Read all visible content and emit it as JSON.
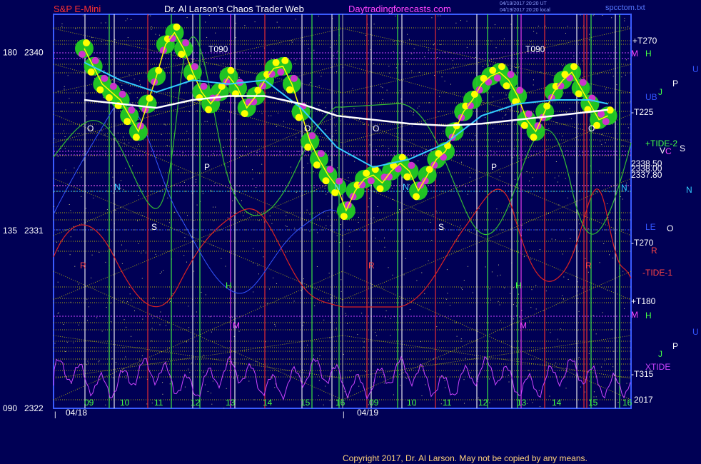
{
  "header": {
    "symbol": "S&P E-Mini",
    "site": "Dr. Al Larson's Chaos Trader Web",
    "url": "Daytradingforecasts.com",
    "stamp1": "04/19/2017 20:20 UT",
    "stamp2": "04/19/2017 20:20 local",
    "file": "spcctom.txt"
  },
  "colors": {
    "background": "#000055",
    "axis": "#3a5cff",
    "gridline": "#d0d000",
    "price_bar": "#ffff00",
    "body_green": "#22cc22",
    "magenta": "#cc33cc",
    "ma_white": "#ffffff",
    "ma_cyan": "#33ccff",
    "tide_green": "#33bb33",
    "tide_red": "#dd2222",
    "xtide": "#cc44ff"
  },
  "copyright": "Copyright 2017, Dr. Al Larson. May not be copied by any means.",
  "chart_data": {
    "type": "line",
    "price_axis": {
      "ticks": [
        {
          "angle": "180",
          "price": "2340",
          "value": 2340
        },
        {
          "angle": "135",
          "price": "2331",
          "value": 2331
        },
        {
          "angle": "090",
          "price": "2322",
          "value": 2322
        }
      ],
      "ylim": [
        2322,
        2341.5
      ]
    },
    "x_axis": {
      "hour_labels": [
        "09",
        "10",
        "11",
        "12",
        "13",
        "14",
        "15",
        "16",
        "09",
        "10",
        "11",
        "12",
        "13",
        "14",
        "15",
        "16"
      ],
      "date_labels": [
        "04/18",
        "04/19"
      ]
    },
    "right_labels": [
      {
        "text": "+T270",
        "color": "#ffffff"
      },
      {
        "text": "M",
        "color": "#ff44ff"
      },
      {
        "text": "H",
        "color": "#44ff44"
      },
      {
        "text": "U",
        "color": "#3355ff"
      },
      {
        "text": "P",
        "color": "#ffffff"
      },
      {
        "text": "J",
        "color": "#44ff44"
      },
      {
        "text": "UB",
        "color": "#3355ff"
      },
      {
        "text": "-T225",
        "color": "#ffffff"
      },
      {
        "text": "+TIDE-2",
        "color": "#44ff44"
      },
      {
        "text": "V",
        "color": "#ffffff"
      },
      {
        "text": "C",
        "color": "#ff44ff"
      },
      {
        "text": "S",
        "color": "#ffffff"
      },
      {
        "text": "2338.50",
        "color": "#ffffff"
      },
      {
        "text": "2338.00",
        "color": "#ffffff"
      },
      {
        "text": "2337.80",
        "color": "#ffffff"
      },
      {
        "text": "N",
        "color": "#33ccff"
      },
      {
        "text": "N",
        "color": "#33ccff"
      },
      {
        "text": "LE",
        "color": "#3355ff"
      },
      {
        "text": "O",
        "color": "#ffffff"
      },
      {
        "text": "-T270",
        "color": "#ffffff"
      },
      {
        "text": "R",
        "color": "#ff4444"
      },
      {
        "text": "-TIDE-1",
        "color": "#ff4444"
      },
      {
        "text": "+T180",
        "color": "#ffffff"
      },
      {
        "text": "M",
        "color": "#ff44ff"
      },
      {
        "text": "H",
        "color": "#44ff44"
      },
      {
        "text": "U",
        "color": "#3355ff"
      },
      {
        "text": "P",
        "color": "#ffffff"
      },
      {
        "text": "J",
        "color": "#44ff44"
      },
      {
        "text": "XTIDE",
        "color": "#cc44ff"
      },
      {
        "text": "-T315",
        "color": "#ffffff"
      },
      {
        "text": "2017",
        "color": "#ffffff"
      }
    ],
    "chart_labels": [
      {
        "text": "T090",
        "color": "#ffffff"
      },
      {
        "text": "T090",
        "color": "#ffffff"
      },
      {
        "text": "O",
        "color": "#ffffff"
      },
      {
        "text": "O",
        "color": "#ffffff"
      },
      {
        "text": "O",
        "color": "#ffffff"
      },
      {
        "text": "O",
        "color": "#ffffff"
      },
      {
        "text": "N",
        "color": "#33ccff"
      },
      {
        "text": "N",
        "color": "#33ccff"
      },
      {
        "text": "N",
        "color": "#33ccff"
      },
      {
        "text": "P",
        "color": "#ffffff"
      },
      {
        "text": "P",
        "color": "#ffffff"
      },
      {
        "text": "S",
        "color": "#ffffff"
      },
      {
        "text": "S",
        "color": "#ffffff"
      },
      {
        "text": "R",
        "color": "#ff4444"
      },
      {
        "text": "R",
        "color": "#ff4444"
      },
      {
        "text": "R",
        "color": "#ff4444"
      },
      {
        "text": "H",
        "color": "#44ff44"
      },
      {
        "text": "H",
        "color": "#44ff44"
      },
      {
        "text": "M",
        "color": "#ff44ff"
      },
      {
        "text": "M",
        "color": "#ff44ff"
      }
    ],
    "price_series": {
      "name": "",
      "points": [
        [
          0,
          2340.2
        ],
        [
          0.25,
          2339.3
        ],
        [
          0.5,
          2338.4
        ],
        [
          0.75,
          2338.0
        ],
        [
          1.0,
          2337.6
        ],
        [
          1.25,
          2336.8
        ],
        [
          1.5,
          2336.0
        ],
        [
          1.75,
          2337.4
        ],
        [
          2.0,
          2338.8
        ],
        [
          2.25,
          2340.4
        ],
        [
          2.5,
          2341.0
        ],
        [
          2.75,
          2340.2
        ],
        [
          3.0,
          2339.0
        ],
        [
          3.25,
          2338.0
        ],
        [
          3.5,
          2337.4
        ],
        [
          3.75,
          2338.0
        ],
        [
          4.0,
          2338.8
        ],
        [
          4.25,
          2338.2
        ],
        [
          4.5,
          2337.2
        ],
        [
          4.75,
          2337.8
        ],
        [
          5.0,
          2338.6
        ],
        [
          5.25,
          2339.2
        ],
        [
          5.5,
          2339.3
        ],
        [
          5.75,
          2338.4
        ],
        [
          6.0,
          2337.0
        ],
        [
          6.25,
          2335.5
        ],
        [
          6.5,
          2334.6
        ],
        [
          6.75,
          2333.8
        ],
        [
          7.0,
          2333.2
        ],
        [
          7.25,
          2332.0
        ],
        [
          7.5,
          2333.0
        ],
        [
          7.75,
          2333.6
        ],
        [
          8.0,
          2333.8
        ],
        [
          8.25,
          2333.4
        ],
        [
          8.5,
          2334.0
        ],
        [
          8.75,
          2334.4
        ],
        [
          9.0,
          2334.0
        ],
        [
          9.25,
          2333.0
        ],
        [
          9.5,
          2333.8
        ],
        [
          9.75,
          2334.6
        ],
        [
          10.0,
          2335.0
        ],
        [
          10.25,
          2336.0
        ],
        [
          10.5,
          2337.0
        ],
        [
          10.75,
          2337.6
        ],
        [
          11.0,
          2338.4
        ],
        [
          11.25,
          2338.8
        ],
        [
          11.5,
          2339.0
        ],
        [
          11.75,
          2338.6
        ],
        [
          12.0,
          2337.8
        ],
        [
          12.25,
          2336.6
        ],
        [
          12.5,
          2336.0
        ],
        [
          12.75,
          2337.0
        ],
        [
          13.0,
          2338.0
        ],
        [
          13.25,
          2338.6
        ],
        [
          13.5,
          2339.0
        ],
        [
          13.75,
          2338.2
        ],
        [
          14.0,
          2337.4
        ],
        [
          14.25,
          2336.6
        ],
        [
          14.5,
          2336.8
        ]
      ]
    },
    "ma_white": {
      "name": "",
      "points": [
        [
          0,
          2337.6
        ],
        [
          1,
          2337.4
        ],
        [
          2,
          2337.2
        ],
        [
          3,
          2337.6
        ],
        [
          4,
          2337.8
        ],
        [
          5,
          2337.8
        ],
        [
          6,
          2337.4
        ],
        [
          7,
          2336.8
        ],
        [
          8,
          2336.6
        ],
        [
          9,
          2336.4
        ],
        [
          10,
          2336.3
        ],
        [
          11,
          2336.4
        ],
        [
          12,
          2336.6
        ],
        [
          13,
          2336.8
        ],
        [
          14,
          2337.0
        ],
        [
          14.5,
          2337.1
        ]
      ]
    },
    "ma_cyan": {
      "name": "",
      "points": [
        [
          0,
          2339.5
        ],
        [
          1,
          2338.6
        ],
        [
          2,
          2338.0
        ],
        [
          3,
          2338.6
        ],
        [
          4,
          2338.4
        ],
        [
          5,
          2338.6
        ],
        [
          6,
          2337.2
        ],
        [
          7,
          2335.2
        ],
        [
          8,
          2334.2
        ],
        [
          9,
          2334.6
        ],
        [
          10,
          2335.4
        ],
        [
          11,
          2336.8
        ],
        [
          12,
          2337.4
        ],
        [
          13,
          2337.6
        ],
        [
          14,
          2337.6
        ],
        [
          14.5,
          2337.4
        ]
      ]
    }
  }
}
